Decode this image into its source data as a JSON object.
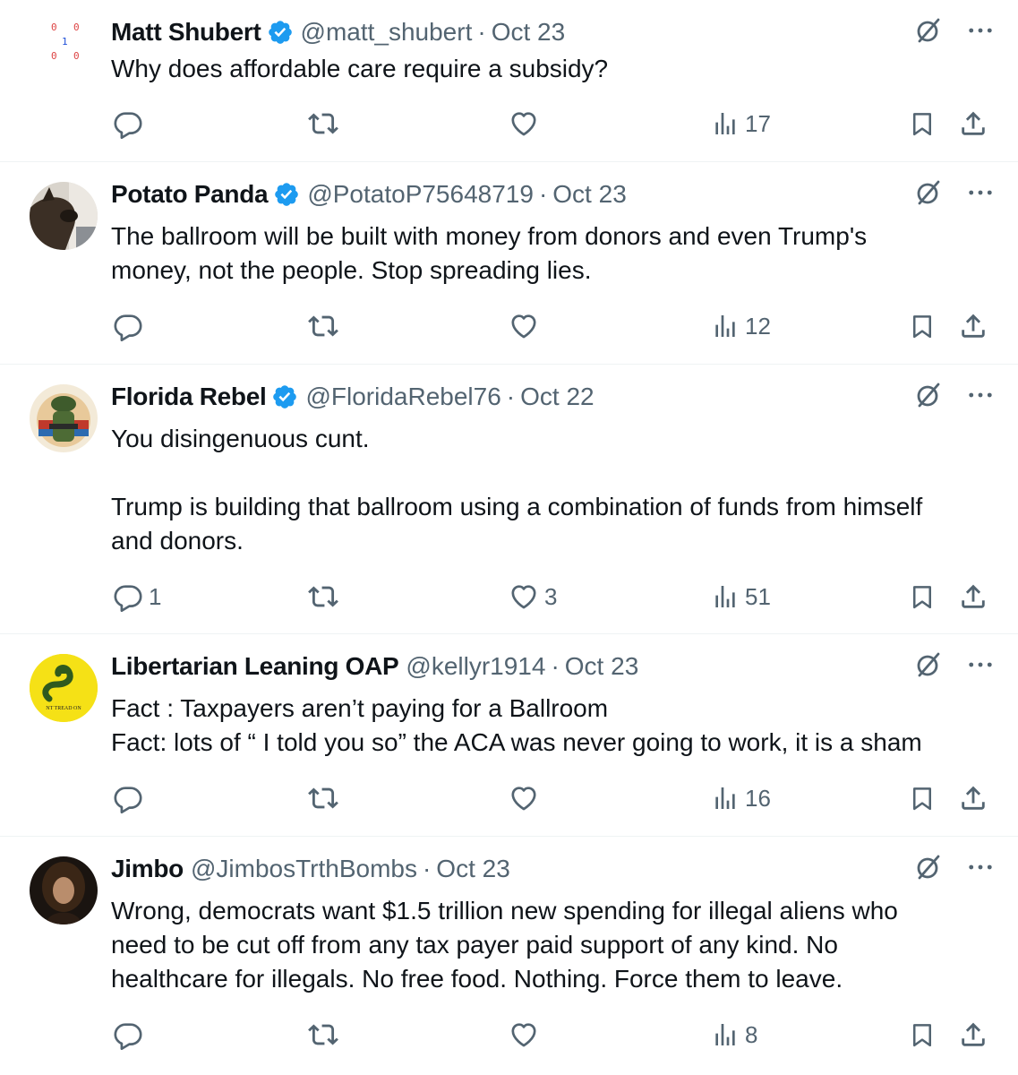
{
  "colors": {
    "text": "#0f1419",
    "muted": "#536471",
    "verified": "#1d9bf0",
    "divider": "#eff3f4"
  },
  "icons": [
    "verified-badge-icon",
    "grok-icon",
    "more-icon",
    "reply-icon",
    "retweet-icon",
    "like-icon",
    "views-icon",
    "bookmark-icon",
    "share-icon"
  ],
  "tweets": [
    {
      "name": "Matt Shubert",
      "handle": "@matt_shubert",
      "sep": "·",
      "date": "Oct 23",
      "text": "Why does affordable care require a subsidy?",
      "replies": "",
      "retweets": "",
      "likes": "",
      "views": "17",
      "avatar": {
        "kind": "digits",
        "d1": "0",
        "d2": "0",
        "d3": "1",
        "d4": "0",
        "d5": "0"
      }
    },
    {
      "name": "Potato Panda",
      "handle": "@PotatoP75648719",
      "sep": "·",
      "date": "Oct 23",
      "text": "The ballroom will be built with money from donors and even Trump's\nmoney, not the people. Stop spreading lies.",
      "replies": "",
      "retweets": "",
      "likes": "",
      "views": "12",
      "avatar": {
        "kind": "dog-photo"
      }
    },
    {
      "name": "Florida Rebel",
      "handle": "@FloridaRebel76",
      "sep": "·",
      "date": "Oct 22",
      "text": "You disingenuous cunt.\n\nTrump is building that ballroom using a combination of funds from himself\nand donors.",
      "replies": "1",
      "retweets": "",
      "likes": "3",
      "views": "51",
      "avatar": {
        "kind": "gator-soldier"
      }
    },
    {
      "name": "Libertarian Leaning OAP",
      "handle": "@kellyr1914",
      "sep": "·",
      "date": "Oct 23",
      "text": "Fact : Taxpayers aren’t paying for a Ballroom\nFact: lots of “ I told you so” the ACA was never going to work, it is a sham",
      "replies": "",
      "retweets": "",
      "likes": "",
      "views": "16",
      "avatar": {
        "kind": "gadsden-flag",
        "text": "NT TREAD ON"
      }
    },
    {
      "name": "Jimbo",
      "handle": "@JimbosTrthBombs",
      "sep": "·",
      "date": "Oct 23",
      "text": "Wrong, democrats want $1.5 trillion new spending for illegal aliens who\nneed to be cut off from any tax payer paid support of any kind. No\nhealthcare for illegals. No free food. Nothing. Force them to leave.",
      "replies": "",
      "retweets": "",
      "likes": "",
      "views": "8",
      "avatar": {
        "kind": "portrait-photo"
      }
    }
  ]
}
